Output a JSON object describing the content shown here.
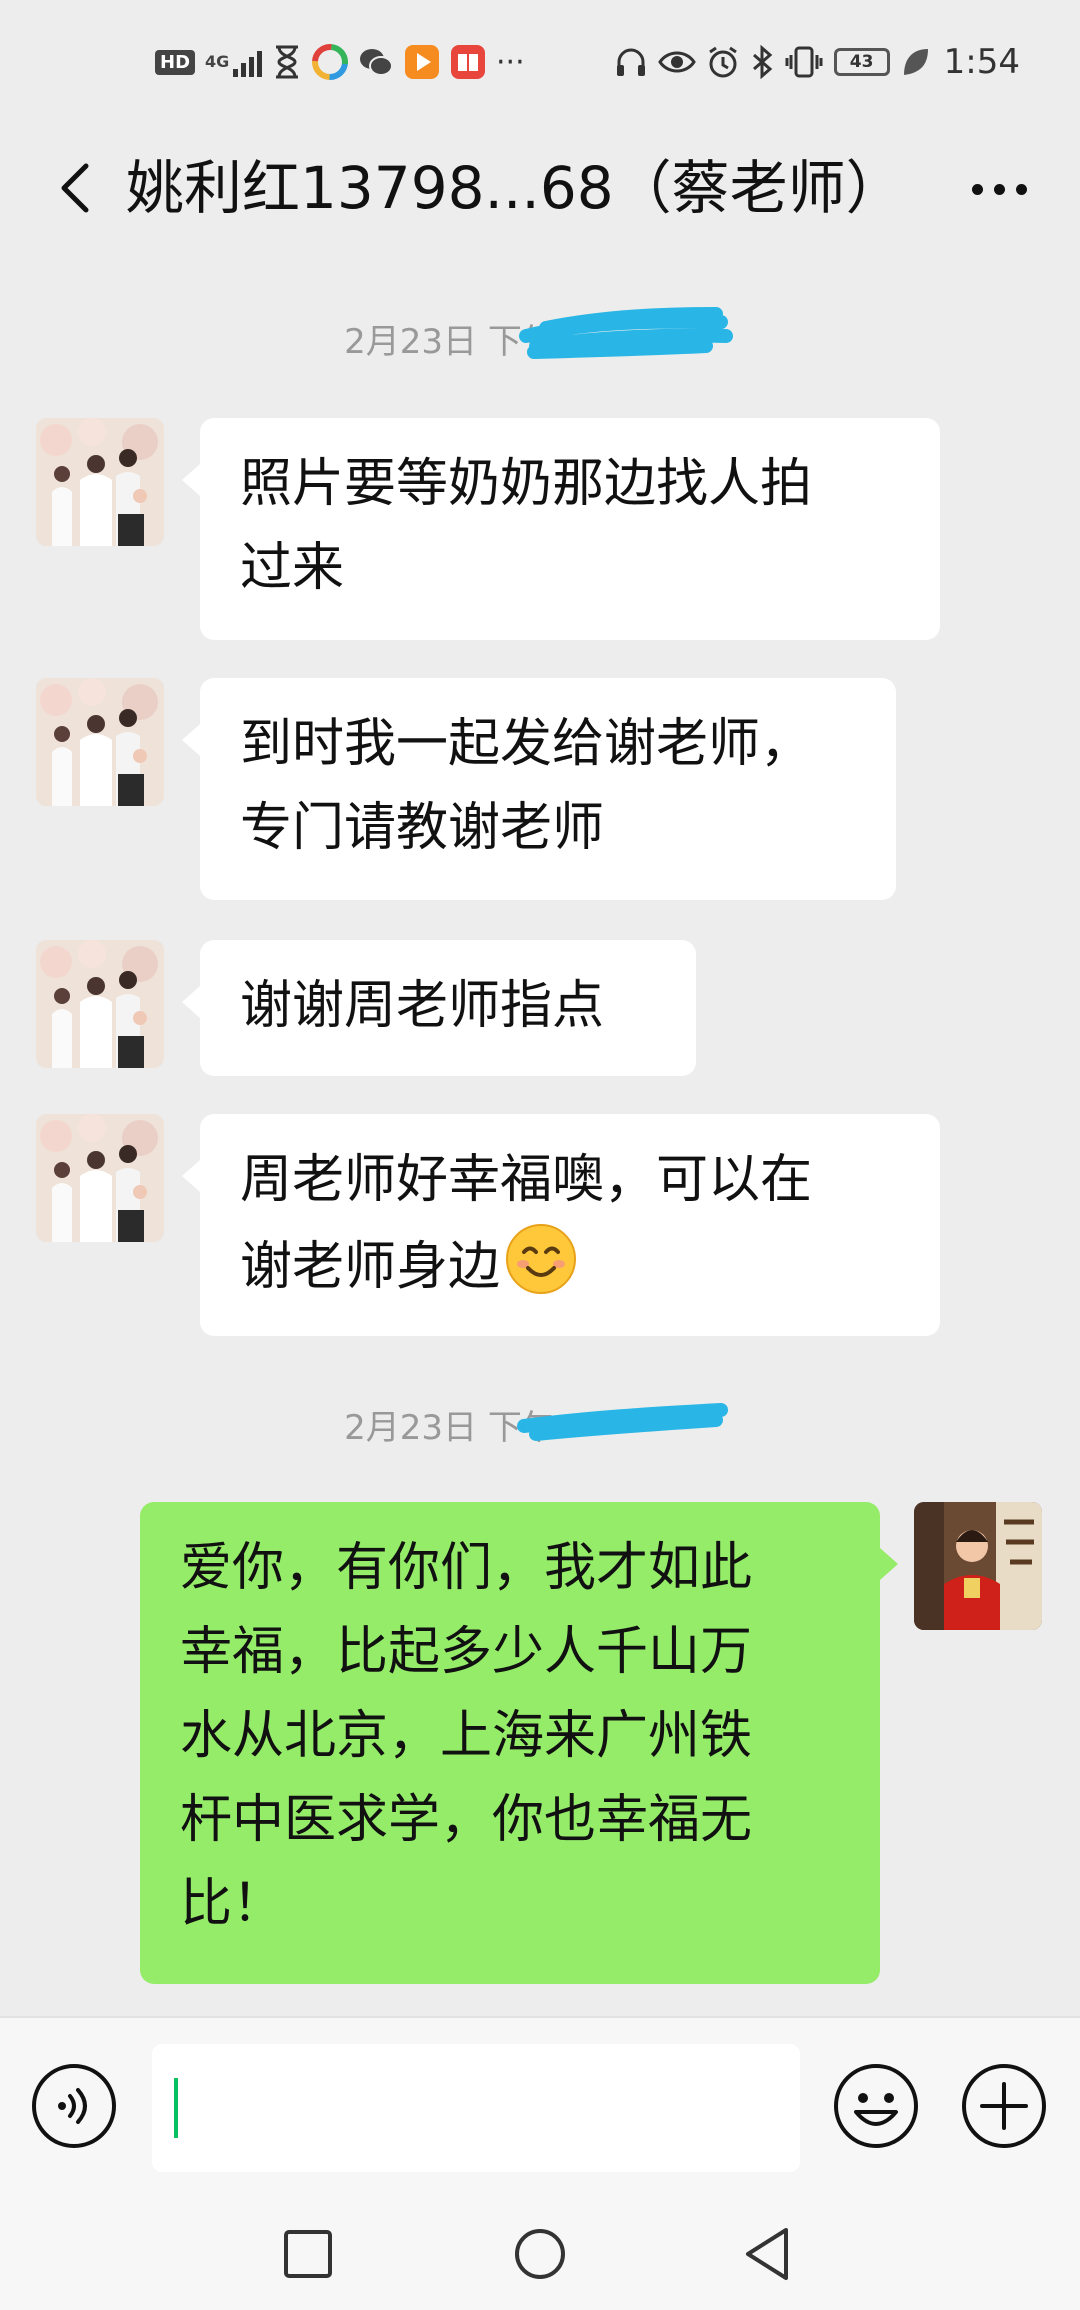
{
  "status_bar": {
    "left_icons": [
      "hd-icon",
      "4g-signal-icon",
      "hourglass-icon",
      "colorful-app-icon",
      "wechat-icon",
      "video-app-icon",
      "book-app-icon"
    ],
    "hd": "HD",
    "network": "4G",
    "overflow": "···",
    "battery": "43",
    "time": "1:54",
    "right_icons": [
      "headset-icon",
      "eye-icon",
      "alarm-icon",
      "bluetooth-icon",
      "vibrate-icon",
      "battery-icon",
      "leaf-icon"
    ]
  },
  "header": {
    "title": "姚利红13798...68（蔡老师）"
  },
  "timestamps": [
    {
      "text": "2月23日 下午"
    },
    {
      "text": "2月23日 下午"
    }
  ],
  "messages": [
    {
      "side": "in",
      "lines": [
        "照片要等奶奶那边找人拍",
        "过来"
      ]
    },
    {
      "side": "in",
      "lines": [
        "到时我一起发给谢老师，",
        "专门请教谢老师"
      ]
    },
    {
      "side": "in",
      "lines": [
        "谢谢周老师指点"
      ]
    },
    {
      "side": "in",
      "lines": [
        "周老师好幸福噢，可以在",
        "谢老师身边"
      ],
      "emoji": "smile-emoji"
    },
    {
      "side": "out",
      "lines": [
        "爱你，有你们，我才如此",
        "幸福，比起多少人千山万",
        "水从北京，上海来广州铁",
        "杆中医求学，你也幸福无",
        "比！"
      ]
    }
  ],
  "colors": {
    "background": "#ededed",
    "incoming_bubble": "#ffffff",
    "outgoing_bubble": "#95ec69",
    "caret": "#07c160",
    "scribble": "#29b6e6"
  }
}
